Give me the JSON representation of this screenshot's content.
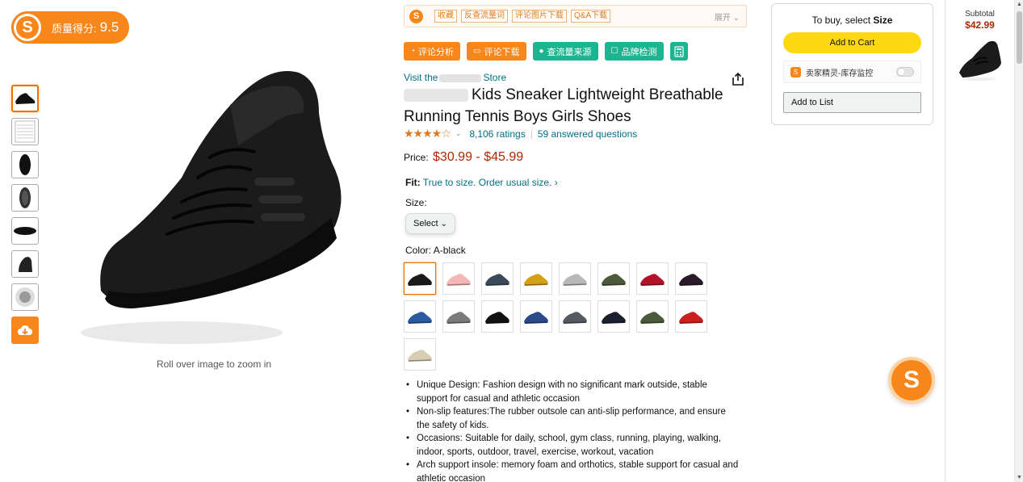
{
  "quality": {
    "logo_letter": "S",
    "label": "质量得分:",
    "score": "9.5"
  },
  "gallery": {
    "thumbnail_count": 7,
    "zoom_hint": "Roll over image to zoom in"
  },
  "plugin_bar": {
    "logo_letter": "S",
    "tags": [
      "收藏",
      "反查流量词",
      "评论图片下载",
      "Q&A下载"
    ],
    "expand": "展开"
  },
  "actions": [
    {
      "label": "评论分析",
      "color": "orange"
    },
    {
      "label": "评论下载",
      "color": "orange"
    },
    {
      "label": "查流量来源",
      "color": "green"
    },
    {
      "label": "品牌检测",
      "color": "green"
    }
  ],
  "product": {
    "visit_prefix": "Visit the",
    "visit_suffix": "Store",
    "title": "Kids Sneaker Lightweight Breathable Running Tennis Boys Girls Shoes",
    "rating_stars": "★★★★☆",
    "ratings": "8,106 ratings",
    "answered": "59 answered questions",
    "price_label": "Price:",
    "price": "$30.99 - $45.99",
    "fit_label": "Fit:",
    "fit_text": "True to size. Order usual size.",
    "size_label": "Size:",
    "size_select": "Select",
    "color_label": "Color:",
    "color_value": "A-black",
    "bullets": [
      "Unique Design: Fashion design with no significant mark outside, stable support for casual and athletic occasion",
      "Non-slip features:The rubber outsole can anti-slip performance, and ensure the safety of kids.",
      "Occasions: Suitable for daily, school, gym class, running, playing, walking, indoor, sports, outdoor, travel, exercise, workout, vacation",
      "Arch support insole: memory foam and orthotics, stable support for casual and athletic occasion"
    ]
  },
  "swatch_colors": [
    "#1a1a1a",
    "#f4b6b6",
    "#3a4a5a",
    "#d4a017",
    "#b8b8b8",
    "#4b5a3a",
    "#b3122a",
    "#2a1a2a",
    "#2c5aa0",
    "#7a7a7a",
    "#111111",
    "#2a4a8a",
    "#555a60",
    "#1a2030",
    "#4a5a3a",
    "#cc1f1f",
    "#d8ccb4"
  ],
  "buy_box": {
    "prompt_prefix": "To buy, select",
    "prompt_bold": "Size",
    "add_to_cart": "Add to Cart",
    "monitor_label": "卖家精灵-库存监控",
    "add_to_list": "Add to List"
  },
  "subtotal": {
    "label": "Subtotal",
    "amount": "$42.99"
  },
  "colors": {
    "accent": "#F7861B",
    "link": "#007185",
    "price": "#B12704",
    "cart": "#FFD814"
  }
}
